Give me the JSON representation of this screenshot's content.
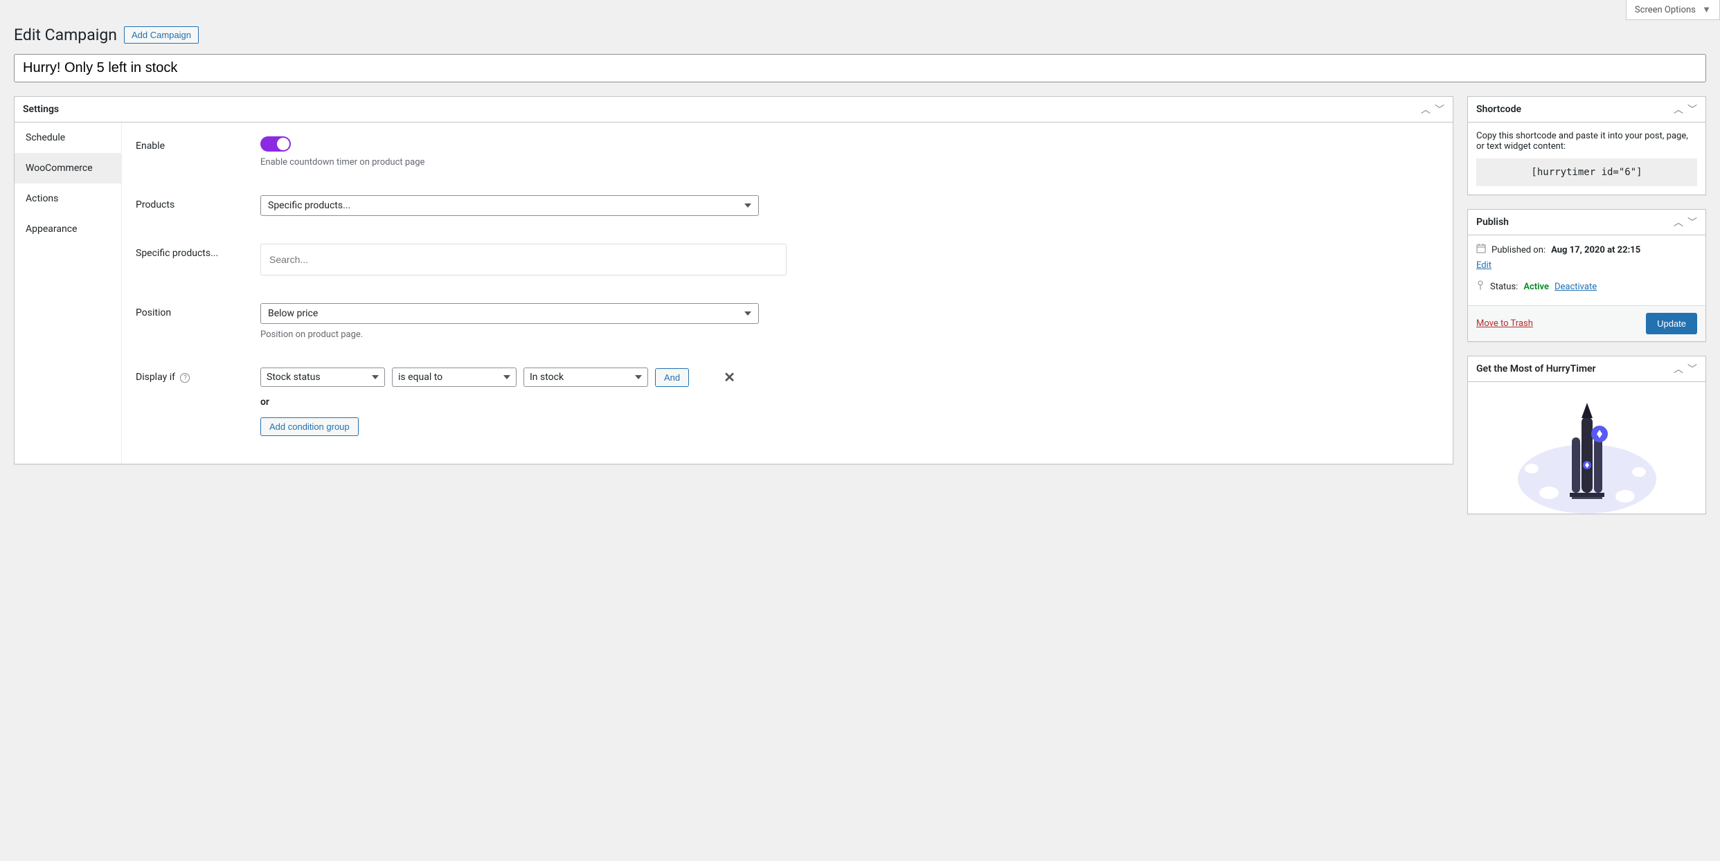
{
  "screenOptions": "Screen Options",
  "pageTitle": "Edit Campaign",
  "addCampaign": "Add Campaign",
  "campaignTitle": "Hurry! Only 5 left in stock",
  "settings": {
    "heading": "Settings",
    "tabs": {
      "schedule": "Schedule",
      "woocommerce": "WooCommerce",
      "actions": "Actions",
      "appearance": "Appearance"
    },
    "enable": {
      "label": "Enable",
      "help": "Enable countdown timer on product page"
    },
    "products": {
      "label": "Products",
      "value": "Specific products..."
    },
    "specificProducts": {
      "label": "Specific products...",
      "placeholder": "Search..."
    },
    "position": {
      "label": "Position",
      "value": "Below price",
      "help": "Position on product page."
    },
    "displayIf": {
      "label": "Display if",
      "condition": {
        "field": "Stock status",
        "operator": "is equal to",
        "value": "In stock",
        "and": "And"
      },
      "or": "or",
      "addGroup": "Add condition group"
    }
  },
  "shortcode": {
    "heading": "Shortcode",
    "desc": "Copy this shortcode and paste it into your post, page, or text widget content:",
    "code": "[hurrytimer id=\"6\"]"
  },
  "publish": {
    "heading": "Publish",
    "publishedOnLabel": "Published on:",
    "publishedOnValue": "Aug 17, 2020 at 22:15",
    "edit": "Edit",
    "statusLabel": "Status:",
    "statusValue": "Active",
    "deactivate": "Deactivate",
    "trash": "Move to Trash",
    "update": "Update"
  },
  "promo": {
    "heading": "Get the Most of HurryTimer"
  }
}
